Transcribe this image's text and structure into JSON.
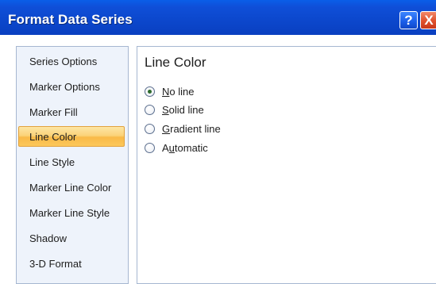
{
  "window": {
    "title": "Format Data Series",
    "help_glyph": "?",
    "close_glyph": "X"
  },
  "nav": {
    "items": [
      {
        "label": "Series Options"
      },
      {
        "label": "Marker Options"
      },
      {
        "label": "Marker Fill"
      },
      {
        "label": "Line Color",
        "selected": true
      },
      {
        "label": "Line Style"
      },
      {
        "label": "Marker Line Color"
      },
      {
        "label": "Marker Line Style"
      },
      {
        "label": "Shadow"
      },
      {
        "label": "3-D Format"
      }
    ]
  },
  "content": {
    "section_title": "Line Color",
    "options": [
      {
        "pre": "",
        "key": "N",
        "post": "o line",
        "checked": true
      },
      {
        "pre": "",
        "key": "S",
        "post": "olid line",
        "checked": false
      },
      {
        "pre": "",
        "key": "G",
        "post": "radient line",
        "checked": false
      },
      {
        "pre": "A",
        "key": "u",
        "post": "tomatic",
        "checked": false
      }
    ]
  },
  "colors": {
    "titlebar": "#0b45c9",
    "selection": "#f9b947",
    "panel_border": "#a6b7d1"
  }
}
